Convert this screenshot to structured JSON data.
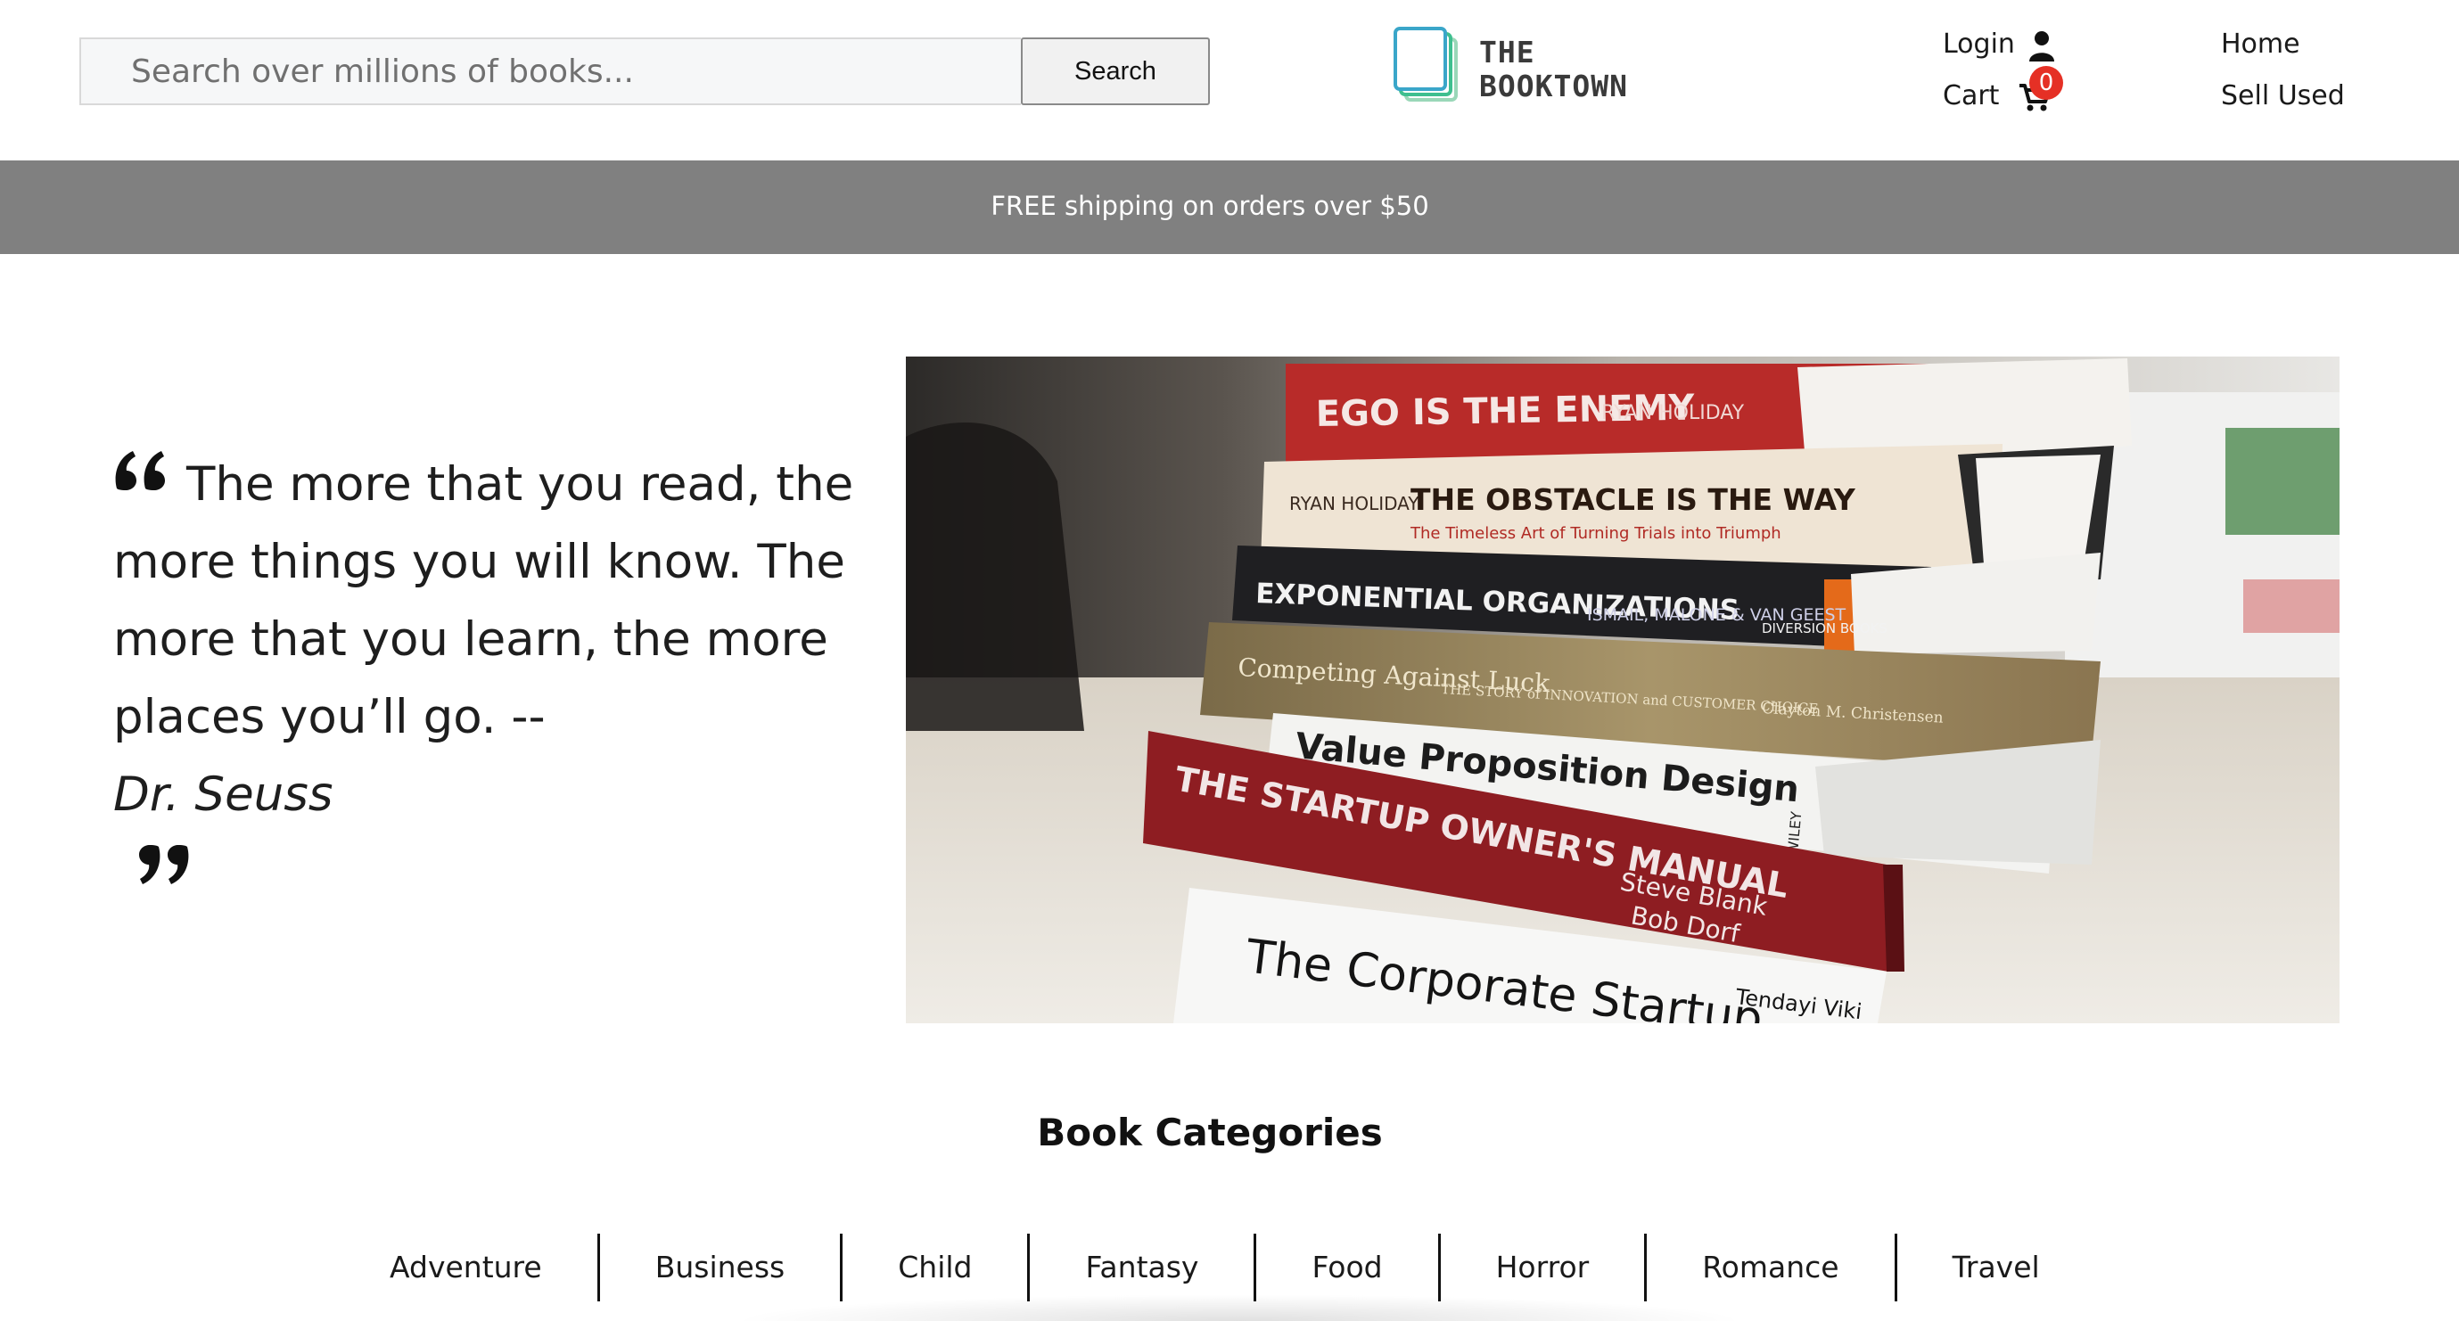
{
  "header": {
    "search_placeholder": "Search over millions of books...",
    "search_button": "Search",
    "logo_line1": "THE",
    "logo_line2": "BOOKTOWN",
    "login": "Login",
    "cart": "Cart",
    "cart_count": "0",
    "home": "Home",
    "sell_used": "Sell Used"
  },
  "banner": {
    "text": "FREE shipping on orders over $50"
  },
  "quote": {
    "text": "The more that you read, the more things you will know. The more that you learn, the more places you’ll go. --",
    "author": "Dr. Seuss"
  },
  "hero": {
    "spines": [
      "EGO IS THE ENEMY",
      "RYAN HOLIDAY",
      "THE OBSTACLE IS THE WAY",
      "The Timeless Art of Turning Trials into Triumph",
      "EXPONENTIAL ORGANIZATIONS",
      "ISMAIL, MALONE & VAN GEEST",
      "DIVERSION BOOKS",
      "Competing Against Luck",
      "THE STORY of INNOVATION and CUSTOMER CHOICE",
      "Clayton M. Christensen",
      "Value Proposition Design",
      "WILEY",
      "THE STARTUP OWNER'S MANUAL",
      "Steve Blank",
      "Bob Dorf",
      "The Corporate Startup",
      "Tendayi Viki"
    ]
  },
  "categories": {
    "title": "Book Categories",
    "items": [
      "Adventure",
      "Business",
      "Child",
      "Fantasy",
      "Food",
      "Horror",
      "Romance",
      "Travel"
    ]
  },
  "colors": {
    "banner_bg": "#808080",
    "badge": "#e53025",
    "logo_green": "#3fbf8f",
    "logo_blue": "#3aa6c9"
  }
}
